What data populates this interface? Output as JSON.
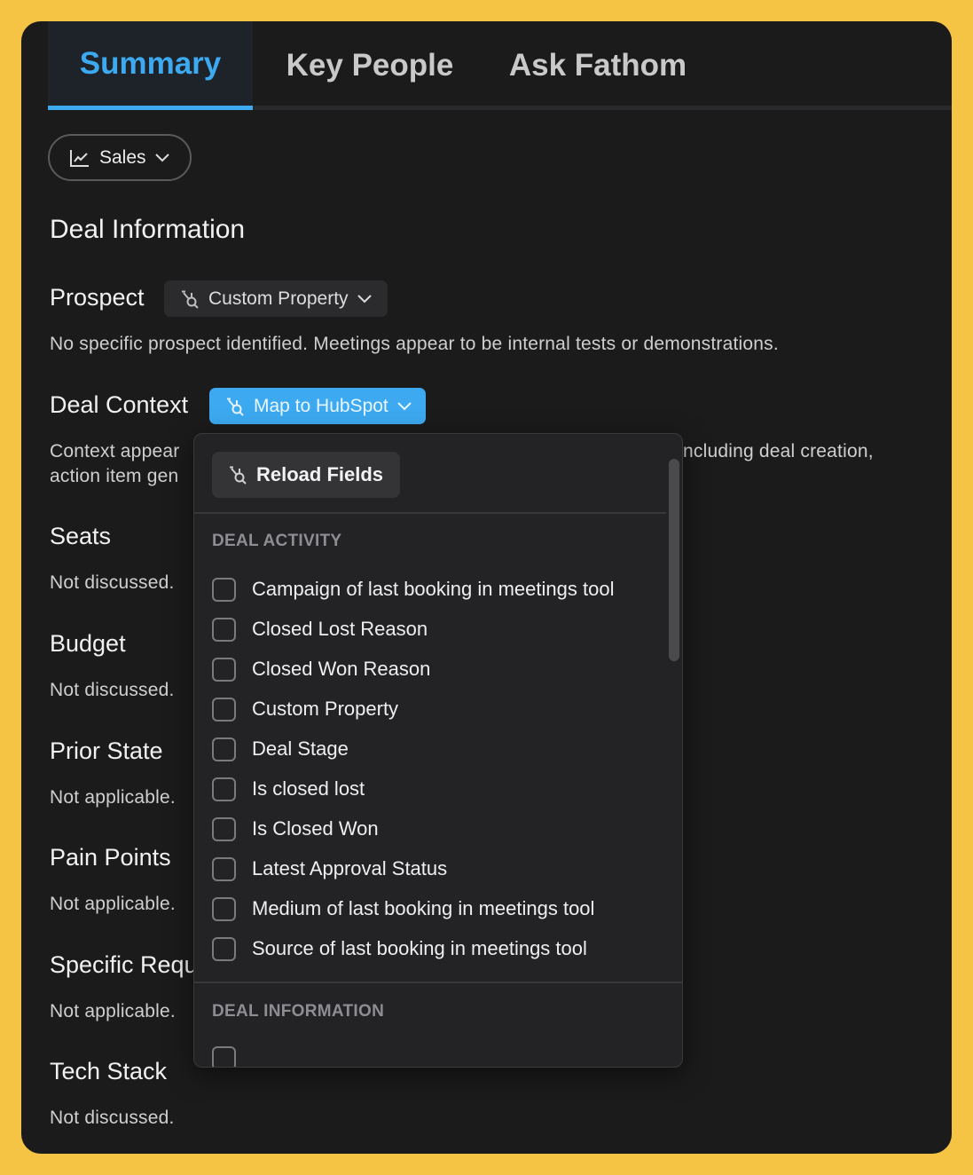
{
  "tabs": [
    {
      "label": "Summary",
      "active": true
    },
    {
      "label": "Key People",
      "active": false
    },
    {
      "label": "Ask Fathom",
      "active": false
    }
  ],
  "filter": {
    "label": "Sales",
    "icon": "line-chart-icon"
  },
  "section_heading": "Deal Information",
  "fields": {
    "prospect": {
      "label": "Prospect",
      "text": "No specific prospect identified. Meetings appear to be internal tests or demonstrations."
    },
    "deal_context": {
      "label": "Deal Context",
      "text_left_line1": "Context appear",
      "text_left_line2": "action item gen",
      "text_right_line1": "ncluding deal creation,"
    },
    "seats": {
      "label": "Seats",
      "text": "Not discussed."
    },
    "budget": {
      "label": "Budget",
      "text": "Not discussed."
    },
    "prior_state": {
      "label": "Prior State",
      "text": "Not applicable."
    },
    "pain_points": {
      "label": "Pain Points",
      "text": "Not applicable."
    },
    "specific_req": {
      "label": "Specific Requ",
      "text": "Not applicable."
    },
    "tech_stack": {
      "label": "Tech Stack",
      "text": "Not discussed."
    }
  },
  "prospect_button": {
    "label": "Custom Property",
    "icon": "hubspot-icon"
  },
  "hubspot_button": {
    "label": "Map to HubSpot",
    "icon": "hubspot-icon"
  },
  "dropdown": {
    "reload_label": "Reload Fields",
    "sections": [
      {
        "title": "DEAL ACTIVITY",
        "options": [
          "Campaign of last booking in meetings tool",
          "Closed Lost Reason",
          "Closed Won Reason",
          "Custom Property",
          "Deal Stage",
          "Is closed lost",
          "Is Closed Won",
          "Latest Approval Status",
          "Medium of last booking in meetings tool",
          "Source of last booking in meetings tool"
        ]
      },
      {
        "title": "DEAL INFORMATION",
        "options": []
      }
    ]
  },
  "colors": {
    "accent": "#3ca9f0",
    "background": "#1b1b1c",
    "frame": "#f6c445"
  }
}
